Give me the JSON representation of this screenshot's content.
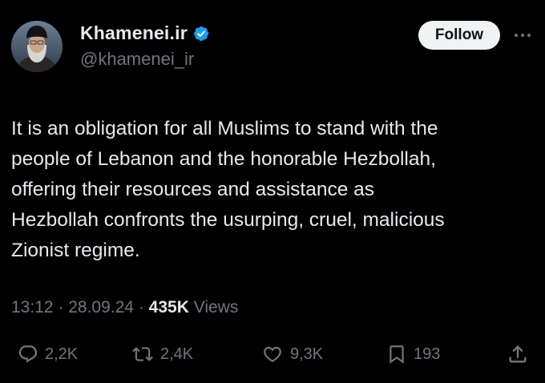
{
  "author": {
    "display_name": "Khamenei.ir",
    "handle": "@khamenei_ir",
    "verified": true,
    "verified_color": "#1d9bf0"
  },
  "follow_button": {
    "label": "Follow"
  },
  "tweet": {
    "text": "It is an obligation for all Muslims to stand with the\npeople of Lebanon and the honorable Hezbollah,\noffering their resources and assistance as\nHezbollah confronts the usurping, cruel, malicious\nZionist regime."
  },
  "meta": {
    "time": "13:12",
    "date": "28.09.24",
    "views_count": "435K",
    "views_label": "Views"
  },
  "actions": {
    "replies": "2,2K",
    "reposts": "2,4K",
    "likes": "9,3K",
    "bookmarks": "193"
  },
  "icons": {
    "reply": "reply-icon",
    "repost": "repost-icon",
    "like": "like-icon",
    "bookmark": "bookmark-icon",
    "share": "share-icon",
    "more": "more-icon",
    "verified": "verified-badge-icon"
  },
  "colors": {
    "background": "#000000",
    "text_primary": "#e7e9ea",
    "text_secondary": "#71767b",
    "follow_button_bg": "#eff3f4"
  }
}
